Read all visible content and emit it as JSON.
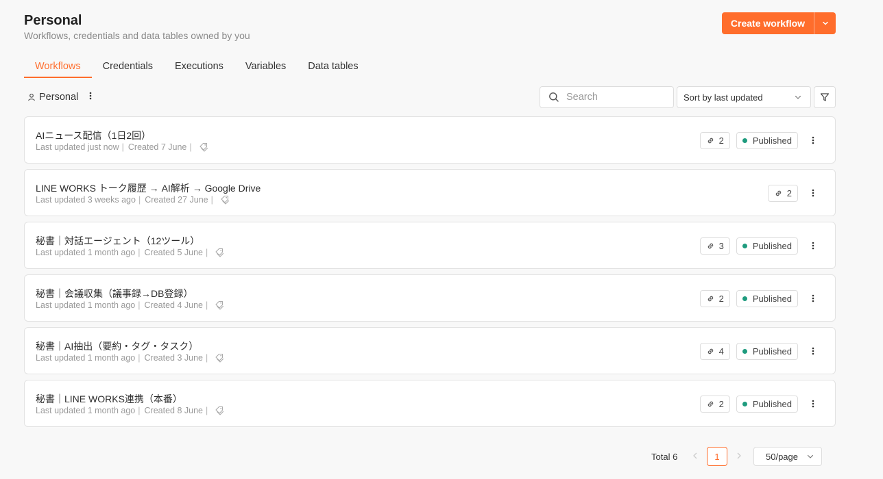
{
  "header": {
    "title": "Personal",
    "subtitle": "Workflows, credentials and data tables owned by you",
    "create_label": "Create workflow"
  },
  "tabs": [
    {
      "label": "Workflows",
      "active": true
    },
    {
      "label": "Credentials",
      "active": false
    },
    {
      "label": "Executions",
      "active": false
    },
    {
      "label": "Variables",
      "active": false
    },
    {
      "label": "Data tables",
      "active": false
    }
  ],
  "toolbar": {
    "project_label": "Personal",
    "search_placeholder": "Search",
    "sort_label": "Sort by last updated"
  },
  "colors": {
    "accent": "#ff6d2c",
    "published": "#1e9b7e"
  },
  "workflows": [
    {
      "name": "AIニュース配信（1日2回）",
      "updated": "Last updated just now",
      "created": "Created 7 June",
      "links": "2",
      "status": "Published"
    },
    {
      "name": "LINE WORKS トーク履歴 → AI解析 → Google Drive",
      "updated": "Last updated 3 weeks ago",
      "created": "Created 27 June",
      "links": "2",
      "status": ""
    },
    {
      "name": "秘書｜対話エージェント（12ツール）",
      "updated": "Last updated 1 month ago",
      "created": "Created 5 June",
      "links": "3",
      "status": "Published"
    },
    {
      "name": "秘書｜会議収集（議事録→DB登録）",
      "updated": "Last updated 1 month ago",
      "created": "Created 4 June",
      "links": "2",
      "status": "Published"
    },
    {
      "name": "秘書｜AI抽出（要約・タグ・タスク）",
      "updated": "Last updated 1 month ago",
      "created": "Created 3 June",
      "links": "4",
      "status": "Published"
    },
    {
      "name": "秘書｜LINE WORKS連携（本番）",
      "updated": "Last updated 1 month ago",
      "created": "Created 8 June",
      "links": "2",
      "status": "Published"
    }
  ],
  "pagination": {
    "total": "Total 6",
    "current_page": "1",
    "page_size": "50/page"
  }
}
